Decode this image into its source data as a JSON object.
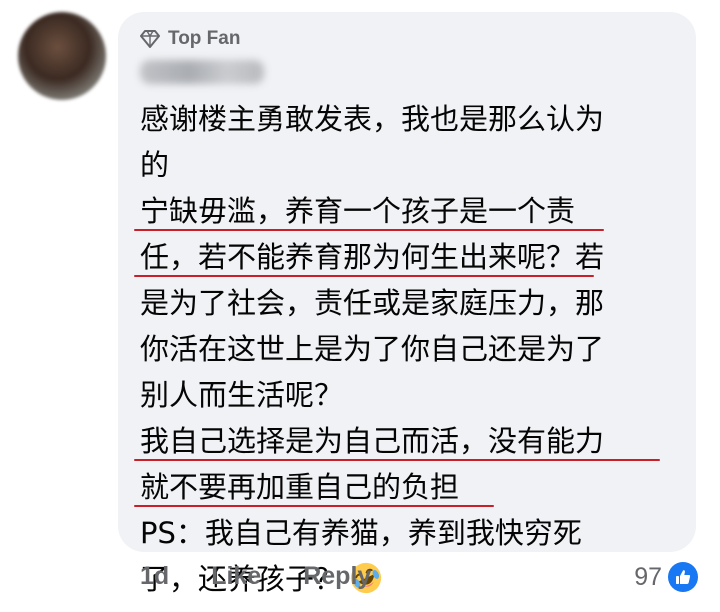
{
  "comment": {
    "badge_label": "Top Fan",
    "badge_icon": "diamond-icon",
    "lines": [
      "感谢楼主勇敢发表，我也是那么认为",
      "的",
      "宁缺毋滥，养育一个孩子是一个责",
      "任，若不能养育那为何生出来呢？若",
      "是为了社会，责任或是家庭压力，那",
      "你活在这世上是为了你自己还是为了",
      "别人而生活呢？",
      "我自己选择是为自己而活，没有能力",
      "就不要再加重自己的负担",
      "PS：我自己有养猫，养到我快穷死",
      "了，还养孩子？"
    ],
    "emoji": "rolling-on-floor-laughing-emoji"
  },
  "footer": {
    "time": "1d",
    "like_label": "Like",
    "reply_label": "Reply"
  },
  "reactions": {
    "count": "97",
    "icon": "like-thumb-icon",
    "color": "#1877f2"
  },
  "colors": {
    "bubble": "#f0f2f5",
    "underline": "#c91f28",
    "meta_text": "#65676b"
  }
}
